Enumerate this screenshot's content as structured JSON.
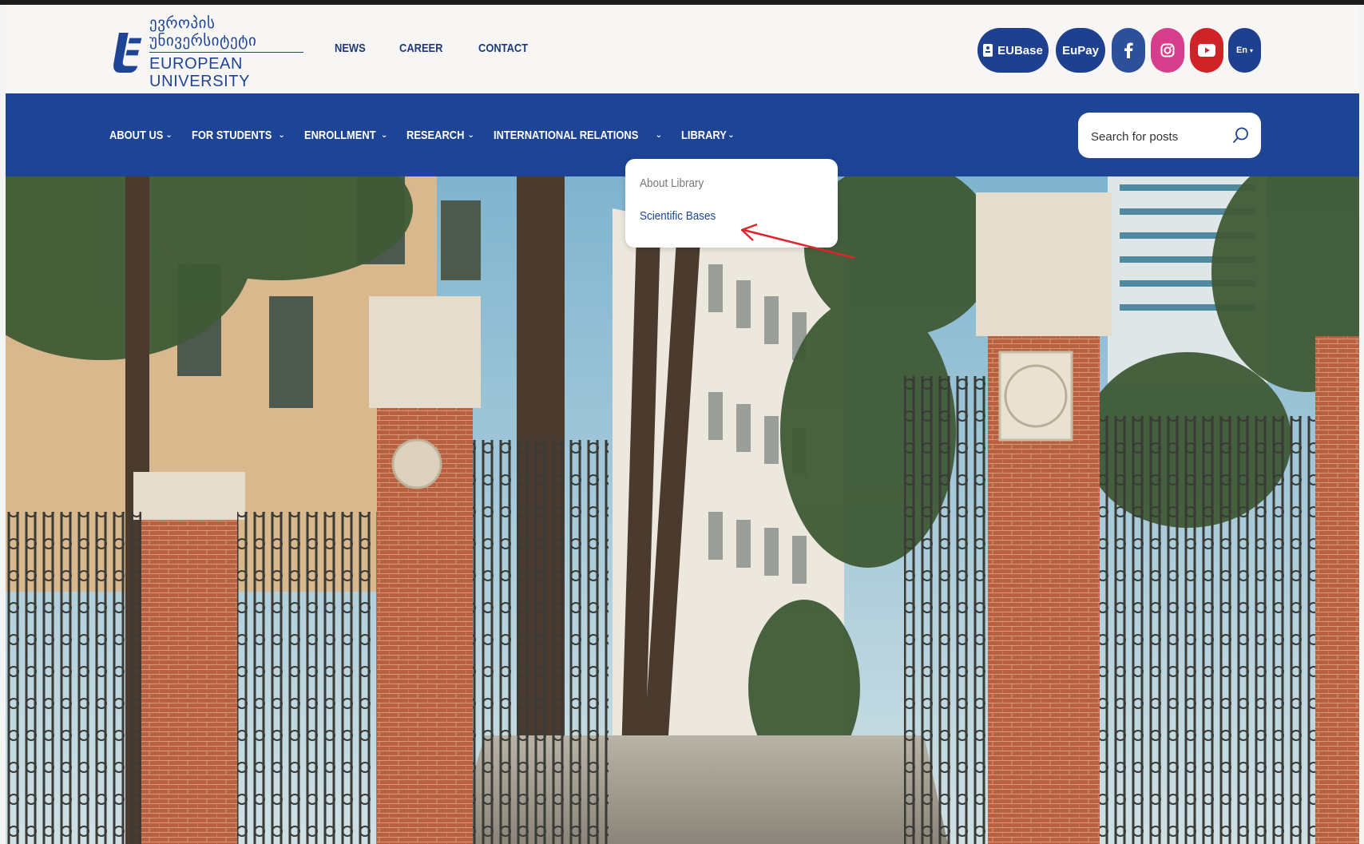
{
  "header": {
    "logo": {
      "georgian": "ევროპის უნივერსიტეტი",
      "english": "EUROPEAN UNIVERSITY"
    },
    "top_nav": [
      "NEWS",
      "CAREER",
      "CONTACT"
    ],
    "buttons": {
      "eubase": "EUBase",
      "eupay": "EuPay",
      "language": "En"
    },
    "social_icons": [
      "facebook-icon",
      "instagram-icon",
      "youtube-icon"
    ]
  },
  "main_nav": {
    "items": [
      {
        "label": "ABOUT US"
      },
      {
        "label": "FOR STUDENTS"
      },
      {
        "label": "ENROLLMENT"
      },
      {
        "label": "RESEARCH"
      },
      {
        "label": "INTERNATIONAL RELATIONS"
      },
      {
        "label": "LIBRARY"
      }
    ],
    "search_placeholder": "Search for posts"
  },
  "library_dropdown": {
    "items": [
      "About Library",
      "Scientific Bases"
    ]
  },
  "colors": {
    "brand_blue": "#1e4496",
    "facebook": "#2e4f9a",
    "instagram": "#d63d8b",
    "youtube": "#cf2328",
    "annotation_arrow": "#e0242b"
  }
}
